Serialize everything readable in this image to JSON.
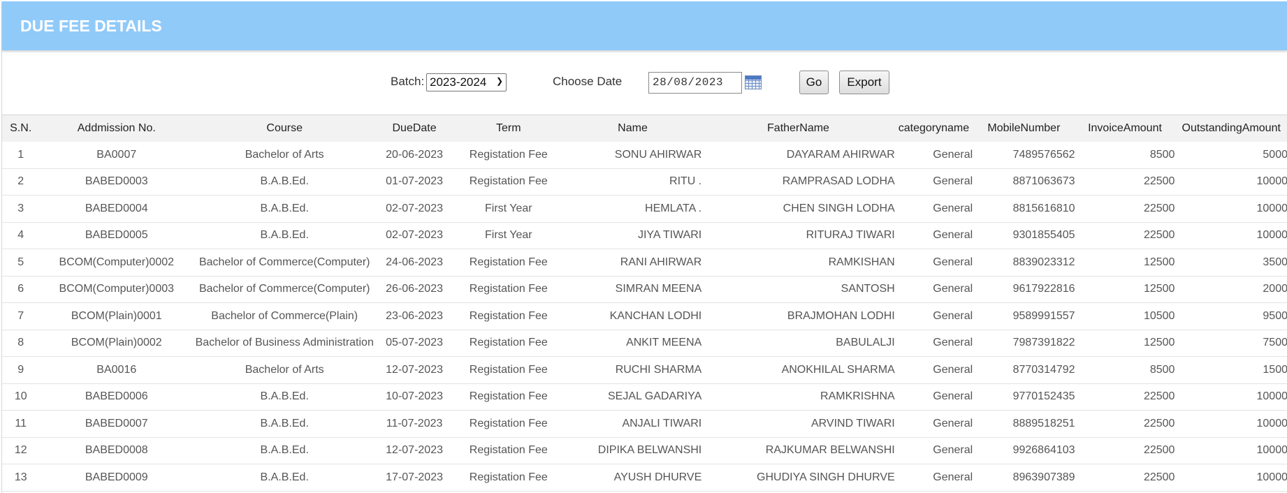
{
  "header": {
    "title": "DUE FEE DETAILS"
  },
  "filters": {
    "batch_label": "Batch:",
    "batch_value": "2023-2024",
    "date_label": "Choose Date",
    "date_value": "28/08/2023",
    "go_label": "Go",
    "export_label": "Export"
  },
  "table": {
    "columns": [
      "S.N.",
      "Addmission No.",
      "Course",
      "DueDate",
      "Term",
      "Name",
      "FatherName",
      "categoryname",
      "MobileNumber",
      "InvoiceAmount",
      "OutstandingAmount"
    ],
    "rows": [
      [
        "1",
        "BA0007",
        "Bachelor of Arts",
        "20-06-2023",
        "Registation Fee",
        "SONU AHIRWAR",
        "DAYARAM AHIRWAR",
        "General",
        "7489576562",
        "8500",
        "5000"
      ],
      [
        "2",
        "BABED0003",
        "B.A.B.Ed.",
        "01-07-2023",
        "Registation Fee",
        "RITU .",
        "RAMPRASAD LODHA",
        "General",
        "8871063673",
        "22500",
        "10000"
      ],
      [
        "3",
        "BABED0004",
        "B.A.B.Ed.",
        "02-07-2023",
        "First Year",
        "HEMLATA .",
        "CHEN SINGH LODHA",
        "General",
        "8815616810",
        "22500",
        "10000"
      ],
      [
        "4",
        "BABED0005",
        "B.A.B.Ed.",
        "02-07-2023",
        "First Year",
        "JIYA TIWARI",
        "RITURAJ TIWARI",
        "General",
        "9301855405",
        "22500",
        "10000"
      ],
      [
        "5",
        "BCOM(Computer)0002",
        "Bachelor of Commerce(Computer)",
        "24-06-2023",
        "Registation Fee",
        "RANI AHIRWAR",
        "RAMKISHAN",
        "General",
        "8839023312",
        "12500",
        "3500"
      ],
      [
        "6",
        "BCOM(Computer)0003",
        "Bachelor of Commerce(Computer)",
        "26-06-2023",
        "Registation Fee",
        "SIMRAN MEENA",
        "SANTOSH",
        "General",
        "9617922816",
        "12500",
        "2000"
      ],
      [
        "7",
        "BCOM(Plain)0001",
        "Bachelor of Commerce(Plain)",
        "23-06-2023",
        "Registation Fee",
        "KANCHAN LODHI",
        "BRAJMOHAN LODHI",
        "General",
        "9589991557",
        "10500",
        "9500"
      ],
      [
        "8",
        "BCOM(Plain)0002",
        "Bachelor of Business Administration",
        "05-07-2023",
        "Registation Fee",
        "ANKIT MEENA",
        "BABULALJI",
        "General",
        "7987391822",
        "12500",
        "7500"
      ],
      [
        "9",
        "BA0016",
        "Bachelor of Arts",
        "12-07-2023",
        "Registation Fee",
        "RUCHI SHARMA",
        "ANOKHILAL SHARMA",
        "General",
        "8770314792",
        "8500",
        "1500"
      ],
      [
        "10",
        "BABED0006",
        "B.A.B.Ed.",
        "10-07-2023",
        "Registation Fee",
        "SEJAL GADARIYA",
        "RAMKRISHNA",
        "General",
        "9770152435",
        "22500",
        "10000"
      ],
      [
        "11",
        "BABED0007",
        "B.A.B.Ed.",
        "11-07-2023",
        "Registation Fee",
        "ANJALI TIWARI",
        "ARVIND TIWARI",
        "General",
        "8889518251",
        "22500",
        "10000"
      ],
      [
        "12",
        "BABED0008",
        "B.A.B.Ed.",
        "12-07-2023",
        "Registation Fee",
        "DIPIKA BELWANSHI",
        "RAJKUMAR BELWANSHI",
        "General",
        "9926864103",
        "22500",
        "10000"
      ],
      [
        "13",
        "BABED0009",
        "B.A.B.Ed.",
        "17-07-2023",
        "Registation Fee",
        "AYUSH DHURVE",
        "GHUDIYA SINGH DHURVE",
        "General",
        "8963907389",
        "22500",
        "10000"
      ]
    ]
  },
  "icons": {
    "date_picker": "calendar-icon",
    "dropdown": "chevron-down-icon"
  },
  "colors": {
    "header_bg": "#90caf9",
    "link": "#1e78d6",
    "table_head_bg": "#f2f2f2"
  }
}
